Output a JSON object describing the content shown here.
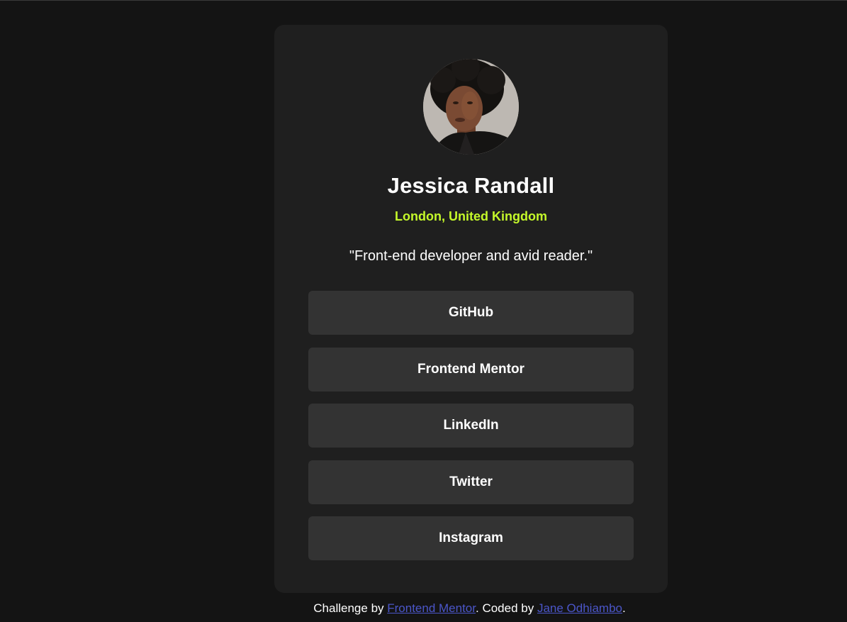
{
  "profile": {
    "name": "Jessica Randall",
    "location": "London, United Kingdom",
    "bio": "\"Front-end developer and avid reader.\"",
    "avatar_icon": "profile-photo"
  },
  "links": [
    {
      "label": "GitHub"
    },
    {
      "label": "Frontend Mentor"
    },
    {
      "label": "LinkedIn"
    },
    {
      "label": "Twitter"
    },
    {
      "label": "Instagram"
    }
  ],
  "attribution": {
    "prefix": "Challenge by ",
    "challenge_link": "Frontend Mentor",
    "middle": ". Coded by ",
    "author_link": "Jane Odhiambo",
    "suffix": "."
  },
  "colors": {
    "page_background": "#141414",
    "card_background": "#1f1f1f",
    "button_background": "#333333",
    "accent": "#c4f82a",
    "link": "#4b56c9"
  }
}
